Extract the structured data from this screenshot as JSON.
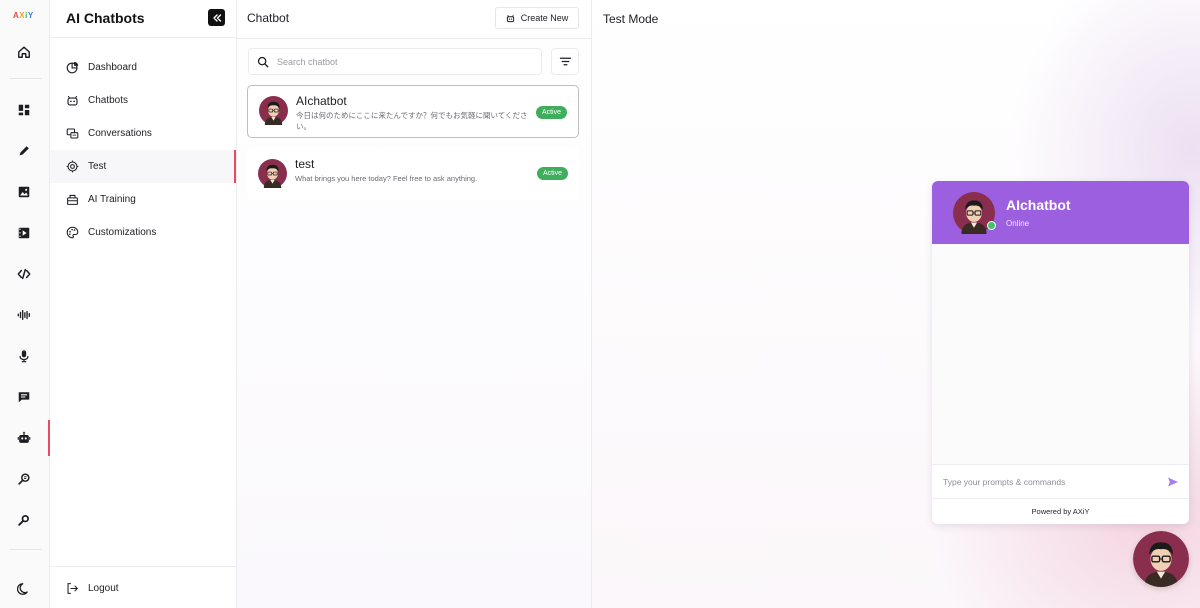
{
  "rail": {
    "logo_letters": [
      "A",
      "X",
      "i",
      "Y"
    ],
    "icons": [
      "home-icon",
      "dashboard-icon",
      "pen-icon",
      "image-icon",
      "video-icon",
      "code-icon",
      "audio-wave-icon",
      "microphone-icon",
      "chat-icon",
      "robot-icon",
      "search-doc-icon",
      "search-icon",
      "moon-icon"
    ]
  },
  "sidebar": {
    "title": "AI Chatbots",
    "items": [
      {
        "label": "Dashboard",
        "icon": "chart-pie-icon"
      },
      {
        "label": "Chatbots",
        "icon": "bot-icon"
      },
      {
        "label": "Conversations",
        "icon": "conversations-icon"
      },
      {
        "label": "Test",
        "icon": "target-icon"
      },
      {
        "label": "AI Training",
        "icon": "training-icon"
      },
      {
        "label": "Customizations",
        "icon": "palette-icon"
      }
    ],
    "logout_label": "Logout"
  },
  "list": {
    "title": "Chatbot",
    "create_label": "Create New",
    "search_placeholder": "Search chatbot",
    "bots": [
      {
        "name": "AIchatbot",
        "description": "今日は何のためにここに来たんですか？何でもお気軽に聞いてください。",
        "status": "Active"
      },
      {
        "name": "test",
        "description": "What brings you here today? Feel free to ask anything.",
        "status": "Active"
      }
    ]
  },
  "test_mode": {
    "title": "Test Mode",
    "widget": {
      "name": "AIchatbot",
      "status": "Online",
      "input_placeholder": "Type your prompts & commands",
      "footer": "Powered by AXiY",
      "header_color": "#9b5fe0"
    }
  },
  "colors": {
    "accent": "#e84a5f",
    "active_badge": "#3fae5c",
    "widget_header": "#9b5fe0"
  }
}
